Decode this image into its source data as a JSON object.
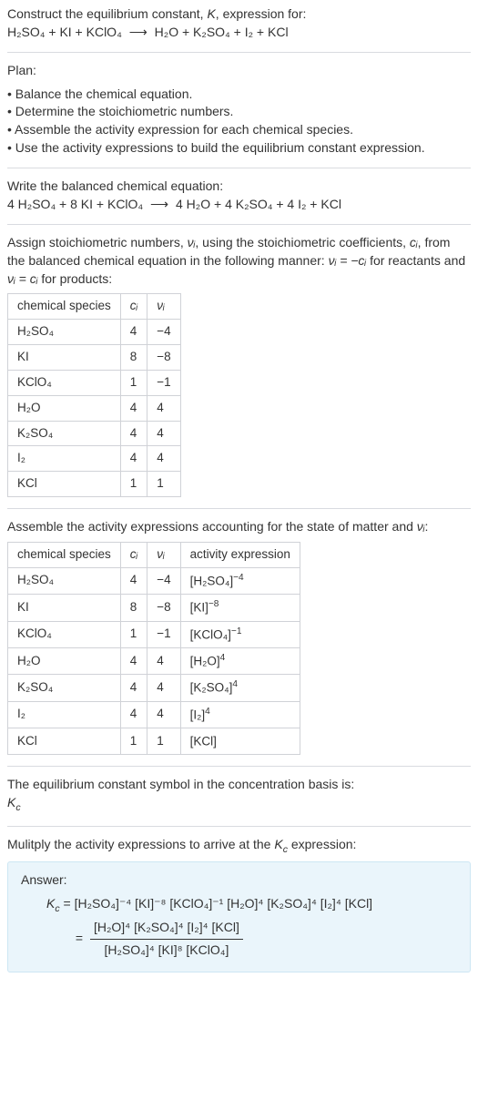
{
  "intro": {
    "heading_prefix": "Construct the equilibrium constant, ",
    "heading_K": "K",
    "heading_suffix": ", expression for:",
    "equation_lhs": "H₂SO₄ + KI + KClO₄",
    "equation_rhs": "H₂O + K₂SO₄ + I₂ + KCl",
    "arrow": "⟶"
  },
  "plan": {
    "label": "Plan:",
    "items": [
      "Balance the chemical equation.",
      "Determine the stoichiometric numbers.",
      "Assemble the activity expression for each chemical species.",
      "Use the activity expressions to build the equilibrium constant expression."
    ]
  },
  "balanced": {
    "label": "Write the balanced chemical equation:",
    "lhs": "4 H₂SO₄ + 8 KI + KClO₄",
    "rhs": "4 H₂O + 4 K₂SO₄ + 4 I₂ + KCl",
    "arrow": "⟶"
  },
  "stoich_intro": {
    "t1": "Assign stoichiometric numbers, ",
    "nu_i": "νᵢ",
    "t2": ", using the stoichiometric coefficients, ",
    "c_i": "cᵢ",
    "t3": ", from the balanced chemical equation in the following manner: ",
    "rel1": "νᵢ = −cᵢ",
    "t4": " for reactants and ",
    "rel2": "νᵢ = cᵢ",
    "t5": " for products:"
  },
  "table1": {
    "h1": "chemical species",
    "h2": "cᵢ",
    "h3": "νᵢ",
    "rows": [
      {
        "sp": "H₂SO₄",
        "c": "4",
        "v": "−4"
      },
      {
        "sp": "KI",
        "c": "8",
        "v": "−8"
      },
      {
        "sp": "KClO₄",
        "c": "1",
        "v": "−1"
      },
      {
        "sp": "H₂O",
        "c": "4",
        "v": "4"
      },
      {
        "sp": "K₂SO₄",
        "c": "4",
        "v": "4"
      },
      {
        "sp": "I₂",
        "c": "4",
        "v": "4"
      },
      {
        "sp": "KCl",
        "c": "1",
        "v": "1"
      }
    ]
  },
  "activity_intro": {
    "t1": "Assemble the activity expressions accounting for the state of matter and ",
    "nu_i": "νᵢ",
    "t2": ":"
  },
  "table2": {
    "h1": "chemical species",
    "h2": "cᵢ",
    "h3": "νᵢ",
    "h4": "activity expression",
    "rows": [
      {
        "sp": "H₂SO₄",
        "c": "4",
        "v": "−4",
        "a_base": "[H₂SO₄]",
        "a_exp": "−4"
      },
      {
        "sp": "KI",
        "c": "8",
        "v": "−8",
        "a_base": "[KI]",
        "a_exp": "−8"
      },
      {
        "sp": "KClO₄",
        "c": "1",
        "v": "−1",
        "a_base": "[KClO₄]",
        "a_exp": "−1"
      },
      {
        "sp": "H₂O",
        "c": "4",
        "v": "4",
        "a_base": "[H₂O]",
        "a_exp": "4"
      },
      {
        "sp": "K₂SO₄",
        "c": "4",
        "v": "4",
        "a_base": "[K₂SO₄]",
        "a_exp": "4"
      },
      {
        "sp": "I₂",
        "c": "4",
        "v": "4",
        "a_base": "[I₂]",
        "a_exp": "4"
      },
      {
        "sp": "KCl",
        "c": "1",
        "v": "1",
        "a_base": "[KCl]",
        "a_exp": ""
      }
    ]
  },
  "symbol_section": {
    "line1": "The equilibrium constant symbol in the concentration basis is:",
    "kc_base": "K",
    "kc_sub": "c"
  },
  "multiply": {
    "t1": "Mulitply the activity expressions to arrive at the ",
    "kc_base": "K",
    "kc_sub": "c",
    "t2": " expression:"
  },
  "answer": {
    "label": "Answer:",
    "kc_base": "K",
    "kc_sub": "c",
    "equals": " = ",
    "flat": "[H₂SO₄]⁻⁴ [KI]⁻⁸ [KClO₄]⁻¹ [H₂O]⁴ [K₂SO₄]⁴ [I₂]⁴ [KCl]",
    "num": "[H₂O]⁴ [K₂SO₄]⁴ [I₂]⁴ [KCl]",
    "den": "[H₂SO₄]⁴ [KI]⁸ [KClO₄]"
  },
  "chart_data": {
    "type": "table",
    "title": "Stoichiometric coefficients and numbers",
    "columns": [
      "chemical species",
      "c_i",
      "nu_i",
      "activity expression"
    ],
    "rows": [
      [
        "H2SO4",
        4,
        -4,
        "[H2SO4]^-4"
      ],
      [
        "KI",
        8,
        -8,
        "[KI]^-8"
      ],
      [
        "KClO4",
        1,
        -1,
        "[KClO4]^-1"
      ],
      [
        "H2O",
        4,
        4,
        "[H2O]^4"
      ],
      [
        "K2SO4",
        4,
        4,
        "[K2SO4]^4"
      ],
      [
        "I2",
        4,
        4,
        "[I2]^4"
      ],
      [
        "KCl",
        1,
        1,
        "[KCl]"
      ]
    ]
  }
}
